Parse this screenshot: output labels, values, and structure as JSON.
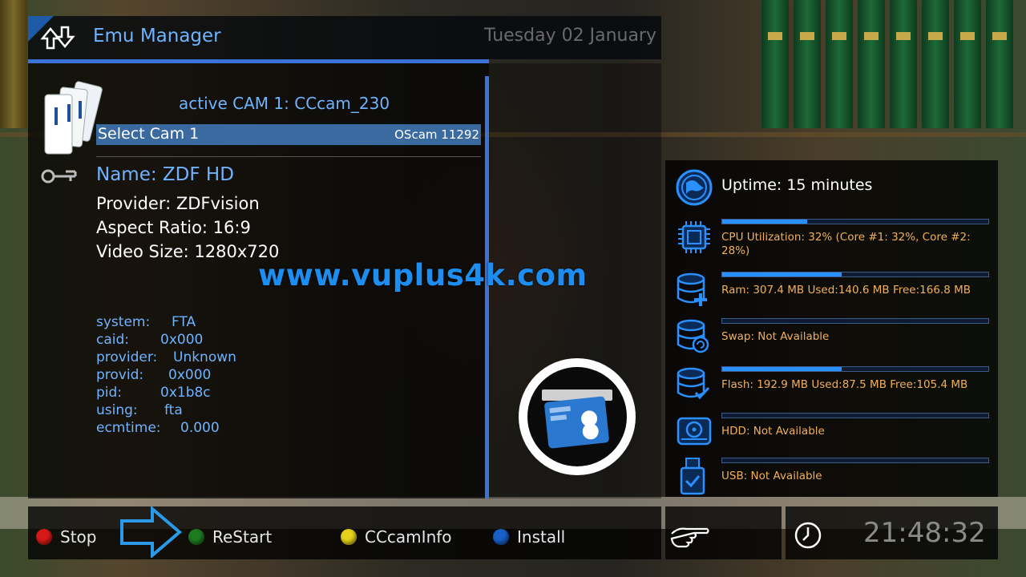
{
  "header": {
    "title": "Emu Manager",
    "date": "Tuesday 02 January",
    "logo_icon": "up-down-arrows-icon"
  },
  "cam": {
    "active_label": "active CAM 1: CCcam_230",
    "select_label": "Select Cam 1",
    "select_value": "OScam 11292"
  },
  "channel": {
    "name": "Name: ZDF HD",
    "provider": "Provider: ZDFvision",
    "aspect": "Aspect Ratio: 16:9",
    "video_size": "Video Size: 1280x720"
  },
  "watermark": "www.vuplus4k.com",
  "ecm": [
    {
      "key": "system:",
      "value": "FTA"
    },
    {
      "key": "caid:",
      "value": "0x000"
    },
    {
      "key": "provider:",
      "value": "Unknown"
    },
    {
      "key": "provid:",
      "value": "0x000"
    },
    {
      "key": "pid:",
      "value": "0x1b8c"
    },
    {
      "key": "using:",
      "value": "fta"
    },
    {
      "key": "ecmtime:",
      "value": "0.000"
    }
  ],
  "system": {
    "uptime": "Uptime: 15 minutes",
    "rows": [
      {
        "icon": "cpu-chip-icon",
        "text": "CPU Utilization: 32% (Core #1:  32%, Core #2:  28%)",
        "fill": 0.32
      },
      {
        "icon": "ram-database-plus-icon",
        "text": "Ram: 307.4 MB Used:140.6 MB Free:166.8 MB",
        "fill": 0.45
      },
      {
        "icon": "swap-database-icon",
        "text": "Swap: Not Available",
        "fill": 0
      },
      {
        "icon": "flash-database-check-icon",
        "text": "Flash: 192.9 MB Used:87.5 MB Free:105.4 MB",
        "fill": 0.45
      },
      {
        "icon": "hdd-icon",
        "text": "HDD: Not Available",
        "fill": 0
      },
      {
        "icon": "usb-stick-icon",
        "text": "USB: Not Available",
        "fill": 0
      }
    ]
  },
  "buttons": {
    "red": {
      "label": "Stop",
      "color": "#d81818"
    },
    "green": {
      "label": "ReStart",
      "color": "#1f7a1f"
    },
    "yellow": {
      "label": "CCcamInfo",
      "color": "#e6d21a"
    },
    "blue": {
      "label": "Install",
      "color": "#1860c8"
    }
  },
  "clock": "21:48:32",
  "colors": {
    "accent": "#3b72d8",
    "label_blue": "#6fb3ff",
    "system_text": "#f0b05a"
  }
}
